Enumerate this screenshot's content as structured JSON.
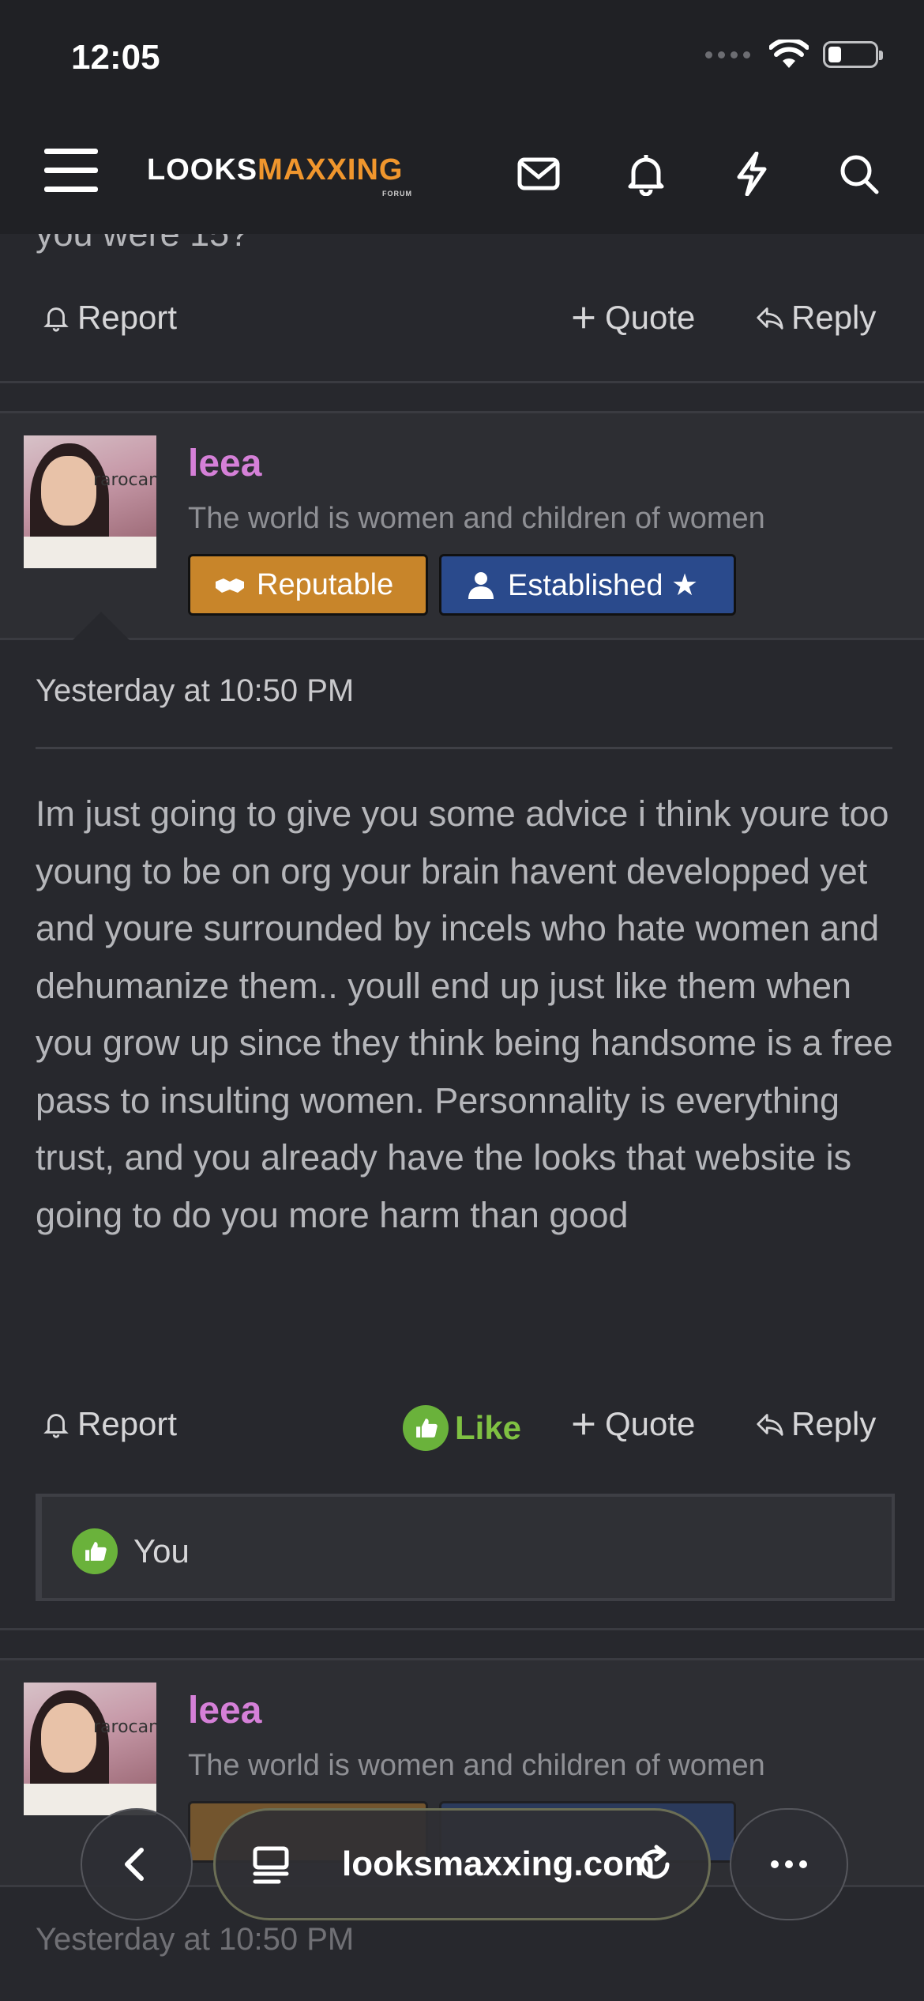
{
  "status_bar": {
    "time": "12:05"
  },
  "header": {
    "logo_part1": "LOOKS",
    "logo_part2": "MAXXING",
    "logo_sub": "FORUM"
  },
  "prev_post": {
    "partial_text": "you were 15?",
    "actions": {
      "report": "Report",
      "quote": "Quote",
      "reply": "Reply"
    }
  },
  "post": {
    "username": "leea",
    "user_title": "The world is women and children of women",
    "badges": [
      {
        "label": "Reputable",
        "color": "#c8852a"
      },
      {
        "label": "Established ★",
        "color": "#2a4a8c"
      }
    ],
    "timestamp": "Yesterday at 10:50 PM",
    "body": "Im just going to give you some advice i think youre too young to be on org your brain havent developped yet and youre surrounded by incels who hate women and dehumanize them.. youll end up just like them when you grow up since they think being handsome is a free pass to insulting women. Personnality is everything trust, and you already have the looks that website is going to do you more harm than good",
    "actions": {
      "report": "Report",
      "like": "Like",
      "quote": "Quote",
      "reply": "Reply"
    },
    "reactions_label": "You",
    "avatar_text": "rarocan"
  },
  "next_post": {
    "username": "leea",
    "user_title": "The world is women and children of women",
    "timestamp": "Yesterday at 10:50 PM",
    "avatar_text": "rarocan"
  },
  "browser": {
    "url": "looksmaxxing.com"
  },
  "colors": {
    "accent": "#f0962d",
    "username": "#d580d8",
    "like": "#6ab23b"
  }
}
